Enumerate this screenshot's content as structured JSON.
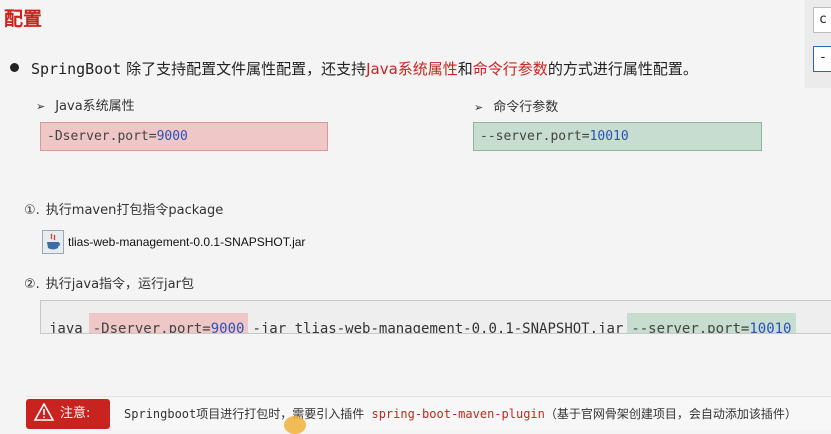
{
  "title": "配置",
  "side": {
    "box1": "c",
    "box2": "-"
  },
  "bullet": {
    "springboot": "SpringBoot",
    "text1": " 除了支持配置文件属性配置，还支持",
    "java_props": "Java系统属性",
    "and": "和",
    "cmd_args": "命令行参数",
    "text2": "的方式进行属性配置。"
  },
  "java_section": {
    "label": "Java系统属性",
    "code_prefix": "-Dserver.port=",
    "code_value": "9000"
  },
  "cmd_section": {
    "label": "命令行参数",
    "code_prefix": "--server.port=",
    "code_value": "10010"
  },
  "step1": {
    "num": "①.",
    "text": "执行maven打包指令package"
  },
  "jar": {
    "filename": "tlias-web-management-0.0.1-SNAPSHOT.jar",
    "icon": "java-jar-icon"
  },
  "step2": {
    "num": "②.",
    "text": "执行java指令，运行jar包"
  },
  "command": {
    "java": "java",
    "dserver_prefix": "-Dserver.port=",
    "dserver_value": "9000",
    "middle": "-jar tlias-web-management-0.0.1-SNAPSHOT.jar",
    "server_prefix": "--server.port=",
    "server_value": "10010"
  },
  "note": {
    "badge": "注意:",
    "text1": "Springboot项目进行打包时，需要引入插件 ",
    "plugin": "spring-boot-maven-plugin",
    "text2": "（基于官网骨架创建项目，会自动添加该插件）"
  },
  "colors": {
    "accent_red": "#c8231e",
    "pink_bg": "#efc7c7",
    "green_bg": "#c6ddd0",
    "number_blue": "#2a52be"
  }
}
